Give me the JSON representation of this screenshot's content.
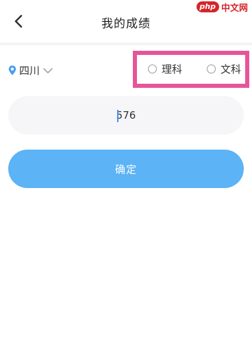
{
  "header": {
    "title": "我的成绩",
    "back_icon": "chevron-left-icon"
  },
  "watermark": {
    "logo": "php",
    "text": "中文网"
  },
  "region": {
    "icon": "location-pin-icon",
    "label": "四川",
    "dropdown_icon": "chevron-down-icon"
  },
  "subject": {
    "options": [
      {
        "label": "理科",
        "selected": false
      },
      {
        "label": "文科",
        "selected": false
      }
    ],
    "highlight_color": "#e6559a"
  },
  "score": {
    "value": "576"
  },
  "confirm": {
    "label": "确定",
    "color": "#5cb3f6"
  }
}
